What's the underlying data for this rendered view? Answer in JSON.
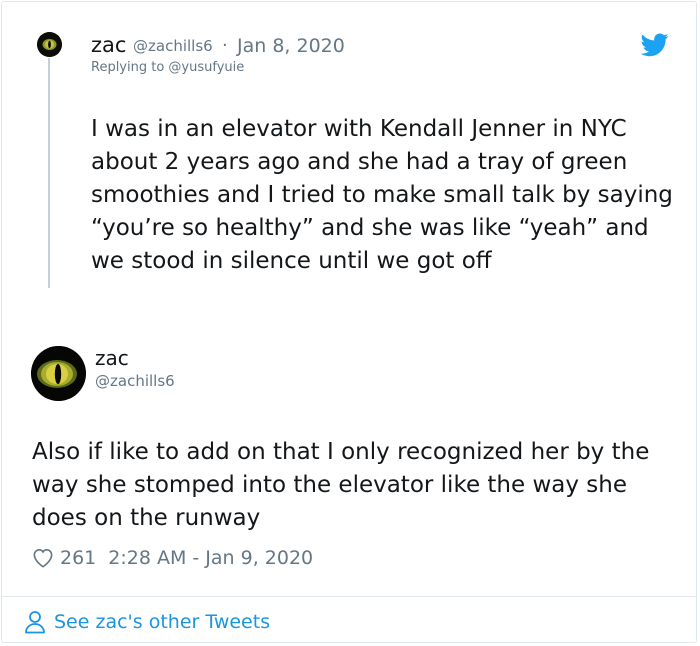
{
  "tweet1": {
    "name": "zac",
    "handle": "@zachills6",
    "separator": "·",
    "date": "Jan 8, 2020",
    "replying_to": "Replying to @yusufyuie",
    "text": "I was in an elevator with Kendall Jenner in NYC about 2 years ago and she had a tray of green smoothies and I tried to make small talk by saying “you’re so healthy” and she was like “yeah” and we stood in silence until we got off"
  },
  "tweet2": {
    "name": "zac",
    "handle": "@zachills6",
    "text": "Also if like to add on that I only recognized her by the way she stomped into the elevator like the way she does on the runway",
    "likes": "261",
    "timestamp": "2:28 AM - Jan 9, 2020"
  },
  "footer": {
    "link_label": "See zac's other Tweets"
  },
  "icons": {
    "brand": "twitter-bird-icon",
    "like": "heart-icon",
    "profile": "person-icon"
  },
  "colors": {
    "accent": "#1da1f2",
    "link": "#1b95e0",
    "muted": "#657786"
  }
}
